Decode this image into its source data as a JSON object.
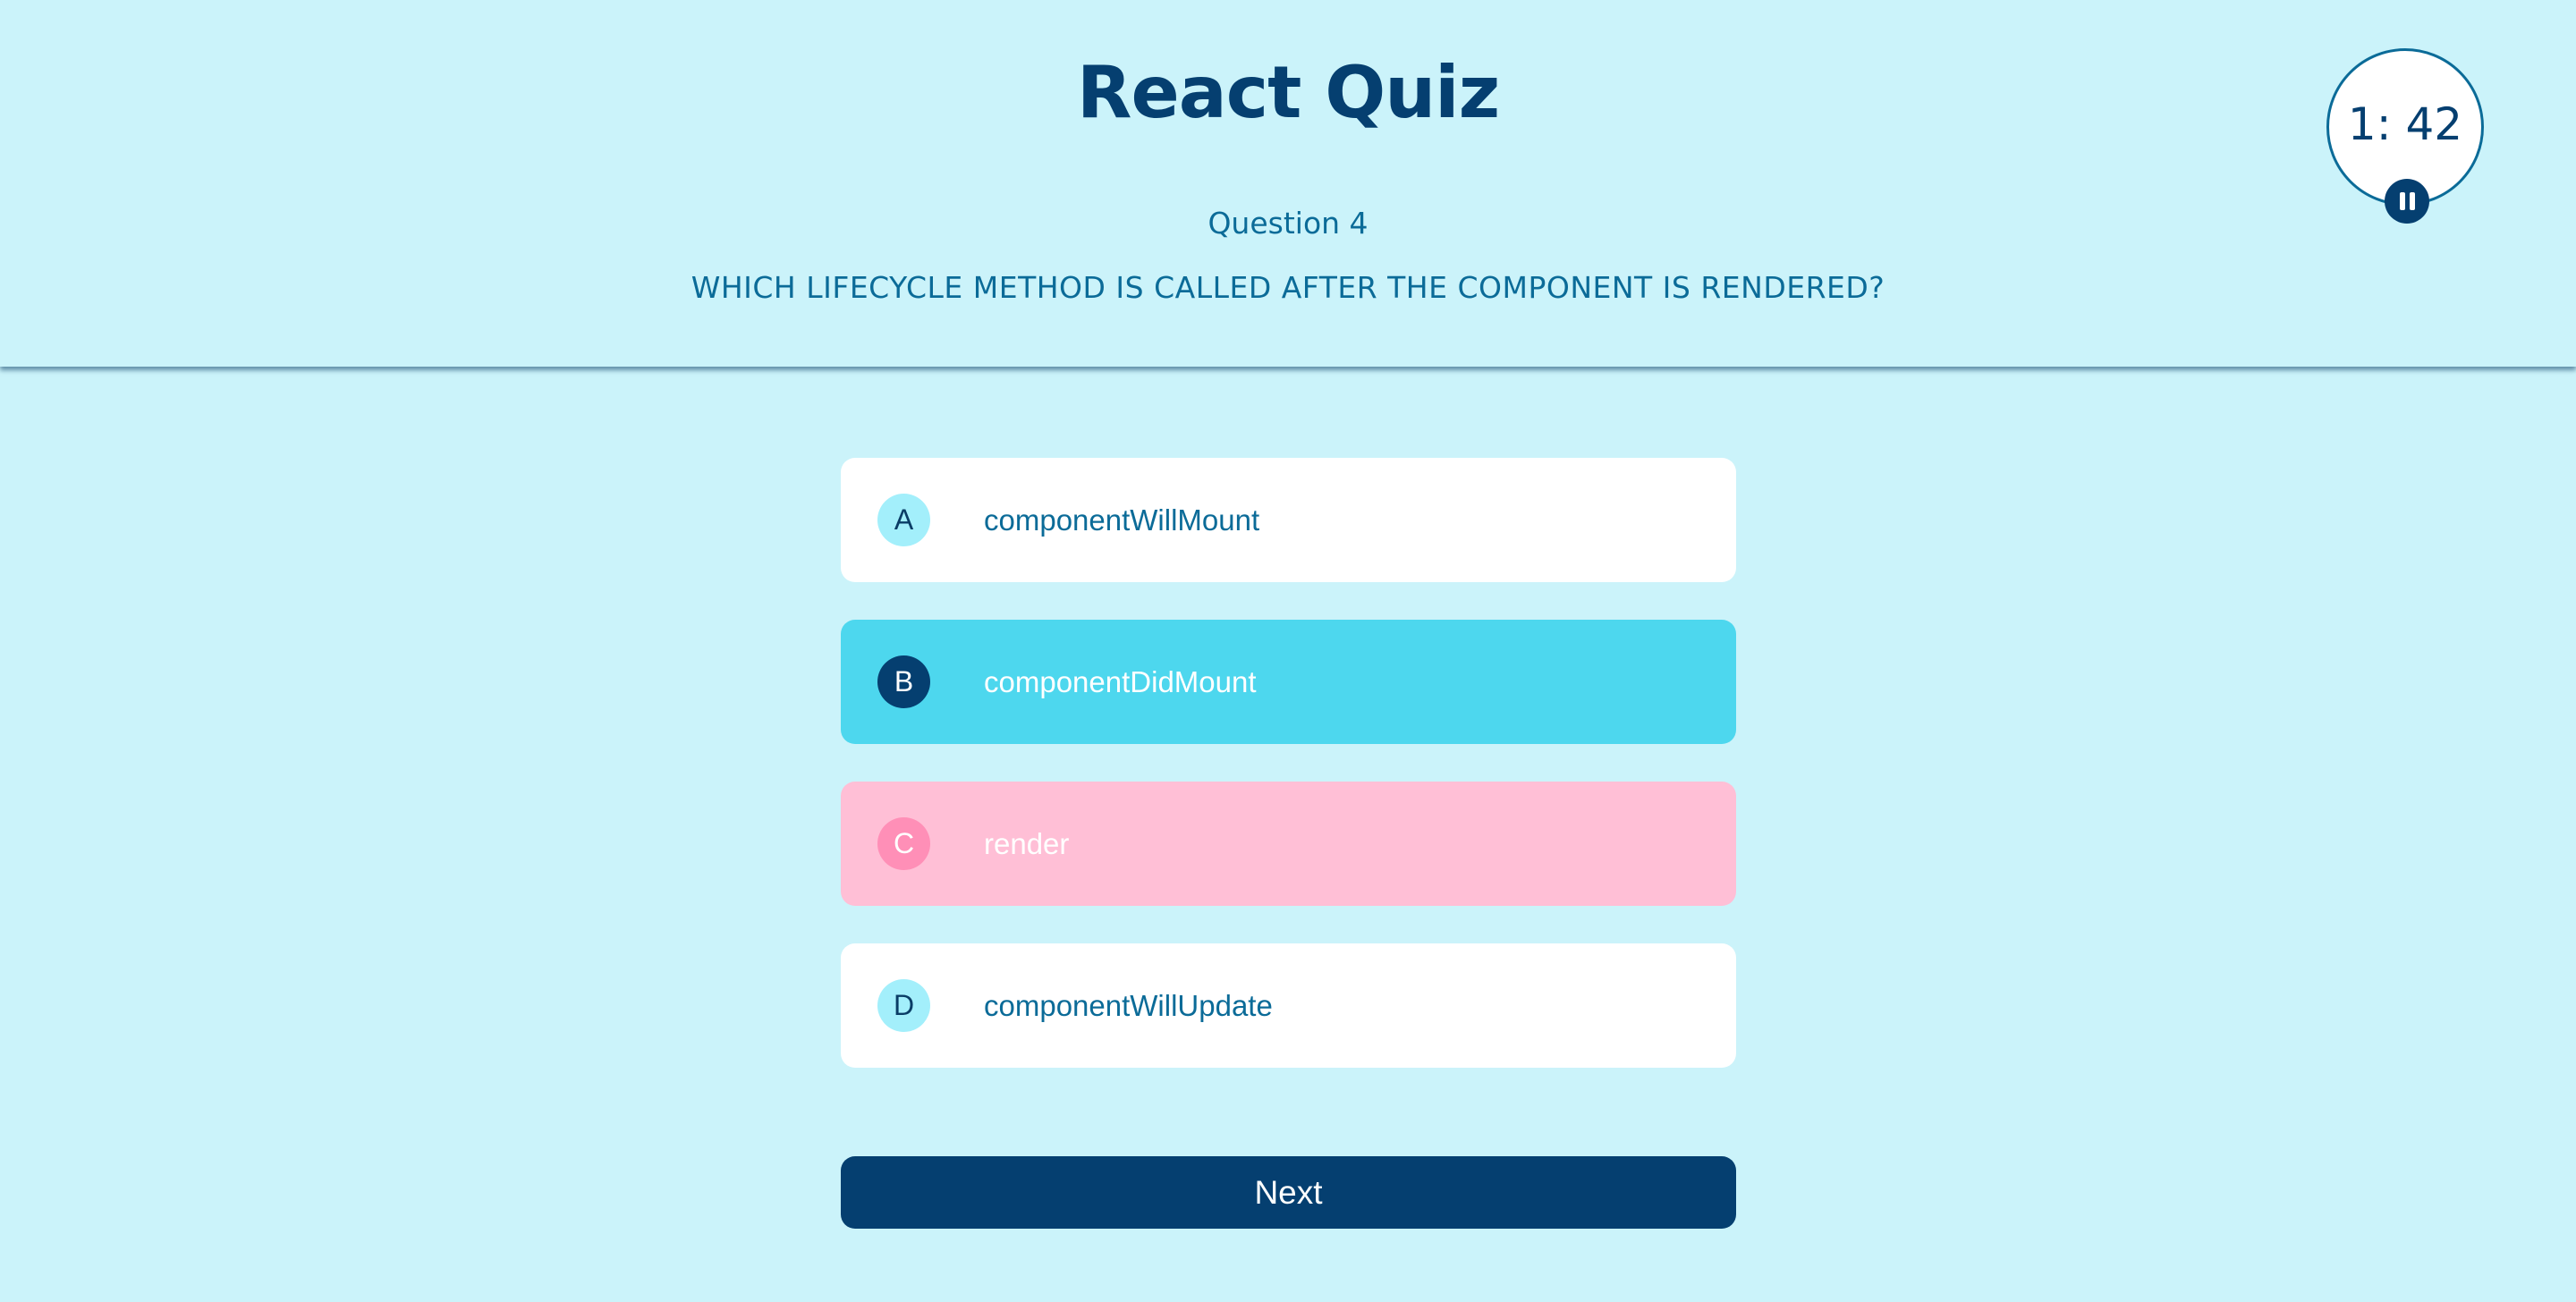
{
  "header": {
    "title": "React Quiz",
    "question_number": "Question 4",
    "question_text": "WHICH LIFECYCLE METHOD IS CALLED AFTER THE COMPONENT IS RENDERED?"
  },
  "timer": {
    "value": "1: 42",
    "pause_icon": "pause-icon"
  },
  "options": [
    {
      "letter": "A",
      "text": "componentWillMount",
      "state": "default"
    },
    {
      "letter": "B",
      "text": "componentDidMount",
      "state": "selected"
    },
    {
      "letter": "C",
      "text": "render",
      "state": "disabled"
    },
    {
      "letter": "D",
      "text": "componentWillUpdate",
      "state": "default"
    }
  ],
  "next_button": {
    "label": "Next"
  },
  "colors": {
    "background": "#cbf3fa",
    "primary": "#053f70",
    "text": "#0b6b98",
    "selected_option": "#4dd7ee",
    "disabled_option": "#ffbfd6"
  }
}
